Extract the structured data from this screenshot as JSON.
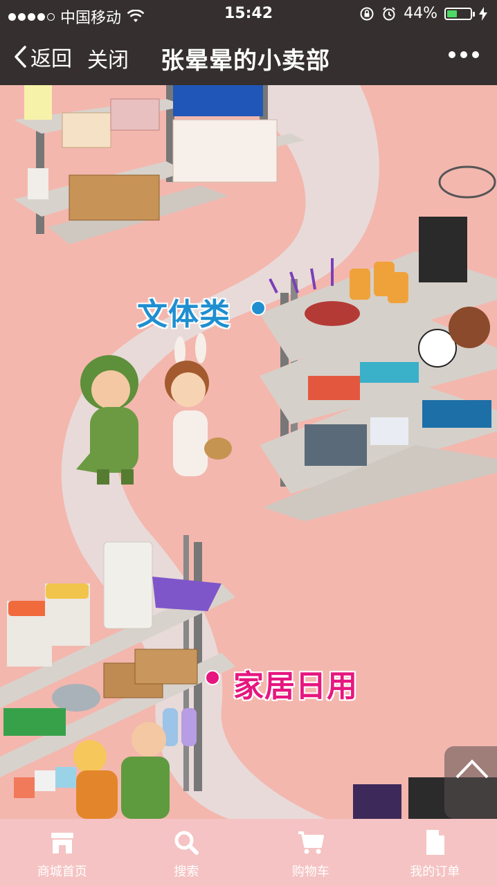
{
  "status_bar": {
    "carrier": "中国移动",
    "time": "15:42",
    "battery": "44%",
    "battery_level": 0.44,
    "battery_color": "#4cd964"
  },
  "nav": {
    "back_label": "返回",
    "close_label": "关闭",
    "title": "张晕晕的小卖部"
  },
  "categories": [
    {
      "label": "文体类",
      "color": "#1f8fd0"
    },
    {
      "label": "家居日用",
      "color": "#e6177f"
    }
  ],
  "tabs": [
    {
      "label": "商城首页",
      "icon": "store-icon"
    },
    {
      "label": "搜索",
      "icon": "search-icon"
    },
    {
      "label": "购物车",
      "icon": "cart-icon"
    },
    {
      "label": "我的订单",
      "icon": "order-document-icon"
    }
  ],
  "colors": {
    "bar_bg": "#35302f",
    "scene_bg": "#f3b7ae",
    "path": "#e6d6d6",
    "tabbar_bg": "#f5c3c3"
  }
}
